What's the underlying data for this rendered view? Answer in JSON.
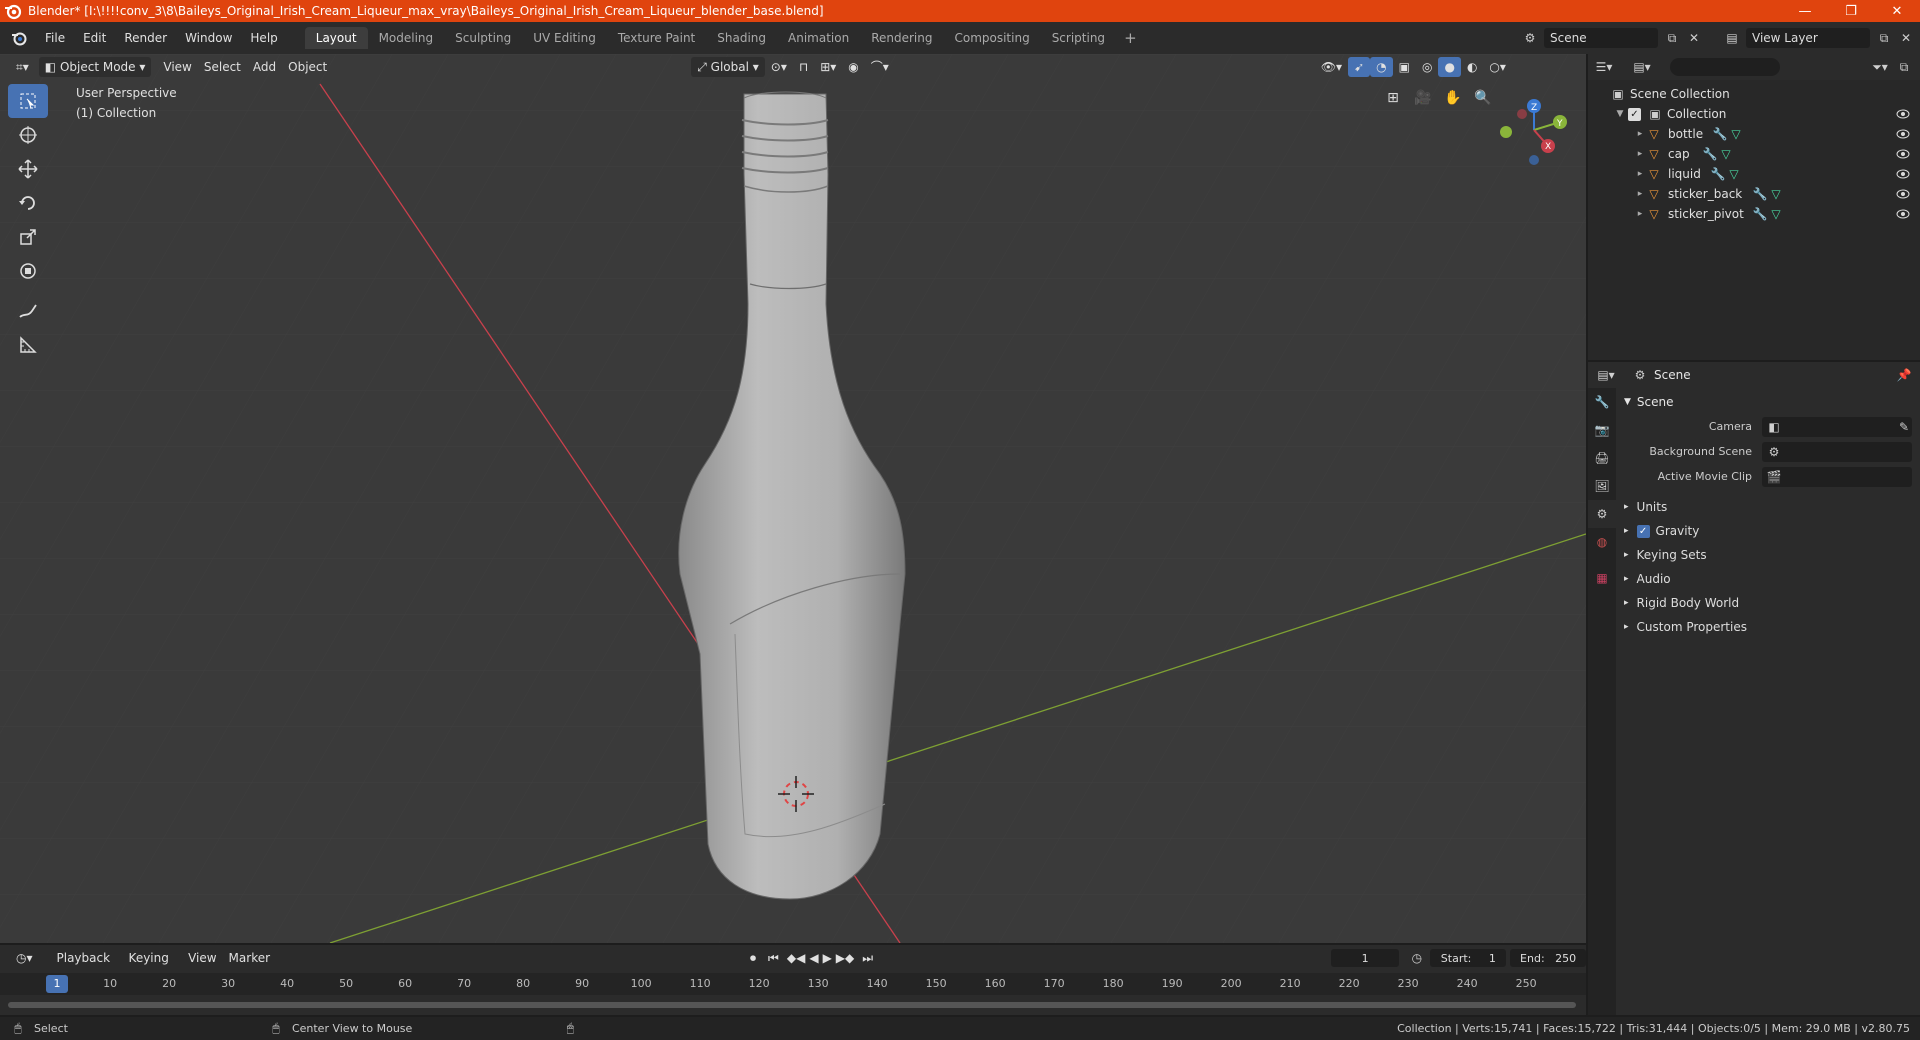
{
  "window": {
    "title": "Blender* [I:\\!!!!conv_3\\8\\Baileys_Original_Irish_Cream_Liqueur_max_vray\\Baileys_Original_Irish_Cream_Liqueur_blender_base.blend]",
    "minimize": "—",
    "maximize": "❐",
    "close": "✕"
  },
  "menubar": {
    "file": "File",
    "edit": "Edit",
    "render": "Render",
    "window": "Window",
    "help": "Help",
    "tabs": [
      "Layout",
      "Modeling",
      "Sculpting",
      "UV Editing",
      "Texture Paint",
      "Shading",
      "Animation",
      "Rendering",
      "Compositing",
      "Scripting"
    ],
    "add_tab": "+",
    "scene": "Scene",
    "view_layer": "View Layer"
  },
  "viewport": {
    "mode": "Object Mode",
    "view": "View",
    "select": "Select",
    "add": "Add",
    "object": "Object",
    "orientation": "Global",
    "perspective": "User Perspective",
    "collection": "(1) Collection",
    "gizmo": {
      "x": "X",
      "y": "Y",
      "z": "Z"
    }
  },
  "outliner": {
    "root": "Scene Collection",
    "collection": "Collection",
    "items": [
      "bottle",
      "cap",
      "liquid",
      "sticker_back",
      "sticker_pivot"
    ]
  },
  "properties": {
    "header": "Scene",
    "panel": "Scene",
    "camera_label": "Camera",
    "bg_scene_label": "Background Scene",
    "movie_clip_label": "Active Movie Clip",
    "subpanels": [
      "Units",
      "Gravity",
      "Keying Sets",
      "Audio",
      "Rigid Body World",
      "Custom Properties"
    ]
  },
  "timeline": {
    "playback": "Playback",
    "keying": "Keying",
    "view": "View",
    "marker": "Marker",
    "current_frame": "1",
    "start_label": "Start:",
    "start": "1",
    "end_label": "End:",
    "end": "250",
    "ticks": [
      "1",
      "10",
      "20",
      "30",
      "40",
      "50",
      "60",
      "70",
      "80",
      "90",
      "100",
      "110",
      "120",
      "130",
      "140",
      "150",
      "160",
      "170",
      "180",
      "190",
      "200",
      "210",
      "220",
      "230",
      "240",
      "250"
    ]
  },
  "status": {
    "select": "Select",
    "center_view": "Center View to Mouse",
    "stats": "Collection | Verts:15,741 | Faces:15,722 | Tris:31,444 | Objects:0/5 | Mem: 29.0 MB | v2.80.75"
  },
  "colors": {
    "title_bar": "#e0440e",
    "active_blue": "#4772b3",
    "x_axis": "#c8404c",
    "y_axis": "#8ab53a",
    "z_axis": "#3b7ad4"
  }
}
